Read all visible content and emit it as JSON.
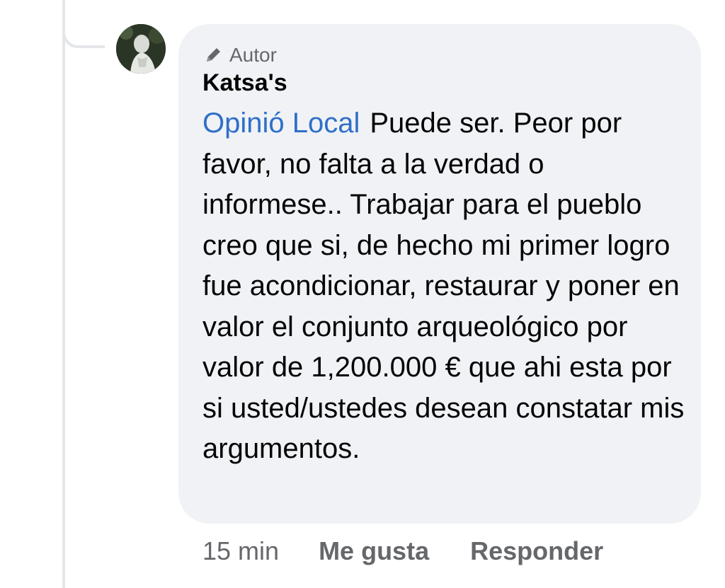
{
  "comment": {
    "author_badge": "Autor",
    "name": "Katsa's",
    "mention": "Opinió Local",
    "text": "Puede ser. Peor por favor, no falta a la verdad o informese.. Trabajar para el pueblo creo que si, de hecho mi primer logro fue acondicionar, restaurar y poner en valor el conjunto arqueológico por valor de 1,200.000 € que ahi esta por si usted/ustedes desean constatar mis argumentos."
  },
  "actions": {
    "time": "15 min",
    "like_label": "Me gusta",
    "reply_label": "Responder"
  },
  "colors": {
    "bubble": "#f0f2f5",
    "mention": "#2f6fc8",
    "secondary_text": "#65676b",
    "primary_text": "#050505"
  },
  "icons": {
    "author_badge": "pencil-icon"
  }
}
